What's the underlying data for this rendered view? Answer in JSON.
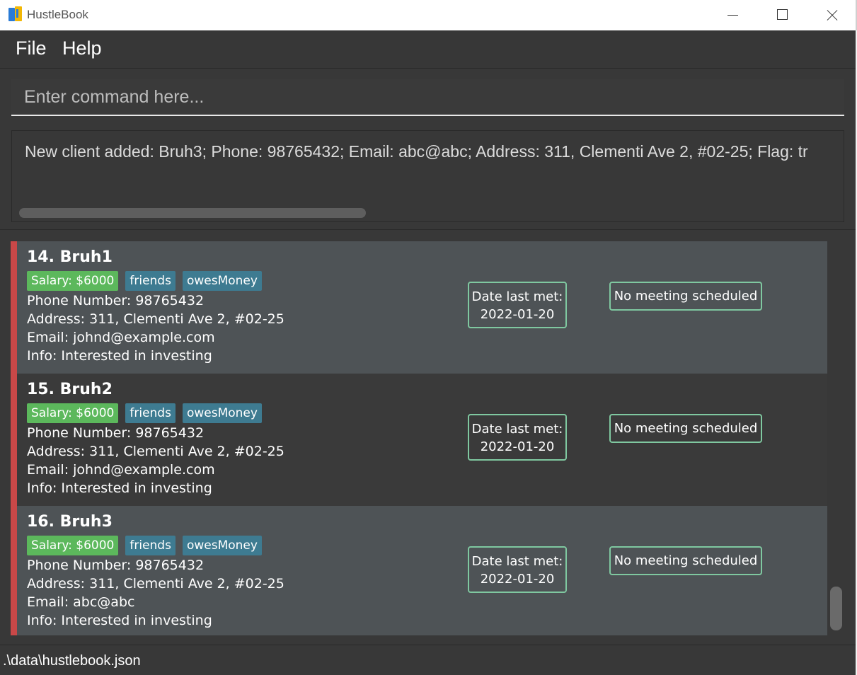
{
  "window": {
    "title": "HustleBook"
  },
  "menu": {
    "file": "File",
    "help": "Help"
  },
  "command": {
    "placeholder": "Enter command here..."
  },
  "result": {
    "text": "New client added: Bruh3; Phone: 98765432; Email: abc@abc; Address: 311, Clementi Ave 2, #02-25; Flag: tr"
  },
  "clients": [
    {
      "title": "14.  Bruh1",
      "tags": [
        "Salary: $6000",
        "friends",
        "owesMoney"
      ],
      "phone": "Phone Number: 98765432",
      "address": "Address: 311, Clementi Ave 2, #02-25",
      "email": "Email: johnd@example.com",
      "info": "Info: Interested in investing",
      "date_label": "Date last met:",
      "date_value": "2022-01-20",
      "meeting": "No meeting scheduled"
    },
    {
      "title": "15.  Bruh2",
      "tags": [
        "Salary: $6000",
        "friends",
        "owesMoney"
      ],
      "phone": "Phone Number: 98765432",
      "address": "Address: 311, Clementi Ave 2, #02-25",
      "email": "Email: johnd@example.com",
      "info": "Info: Interested in investing",
      "date_label": "Date last met:",
      "date_value": "2022-01-20",
      "meeting": "No meeting scheduled"
    },
    {
      "title": "16.  Bruh3",
      "tags": [
        "Salary: $6000",
        "friends",
        "owesMoney"
      ],
      "phone": "Phone Number: 98765432",
      "address": "Address: 311, Clementi Ave 2, #02-25",
      "email": "Email: abc@abc",
      "info": "Info: Interested in investing",
      "date_label": "Date last met:",
      "date_value": "2022-01-20",
      "meeting": "No meeting scheduled"
    }
  ],
  "status": {
    "path": ".\\data\\hustlebook.json"
  },
  "colors": {
    "background": "#383838",
    "card_odd": "#4e5356",
    "card_even": "#3a3a3a",
    "accent_bar": "#c94848",
    "salary_tag": "#5cb85c",
    "tag": "#3e7b91",
    "box_border": "#7fc8a0"
  },
  "icons": {
    "app": "hustlebook-app-icon",
    "minimize": "minimize-icon",
    "maximize": "maximize-icon",
    "close": "close-icon"
  }
}
